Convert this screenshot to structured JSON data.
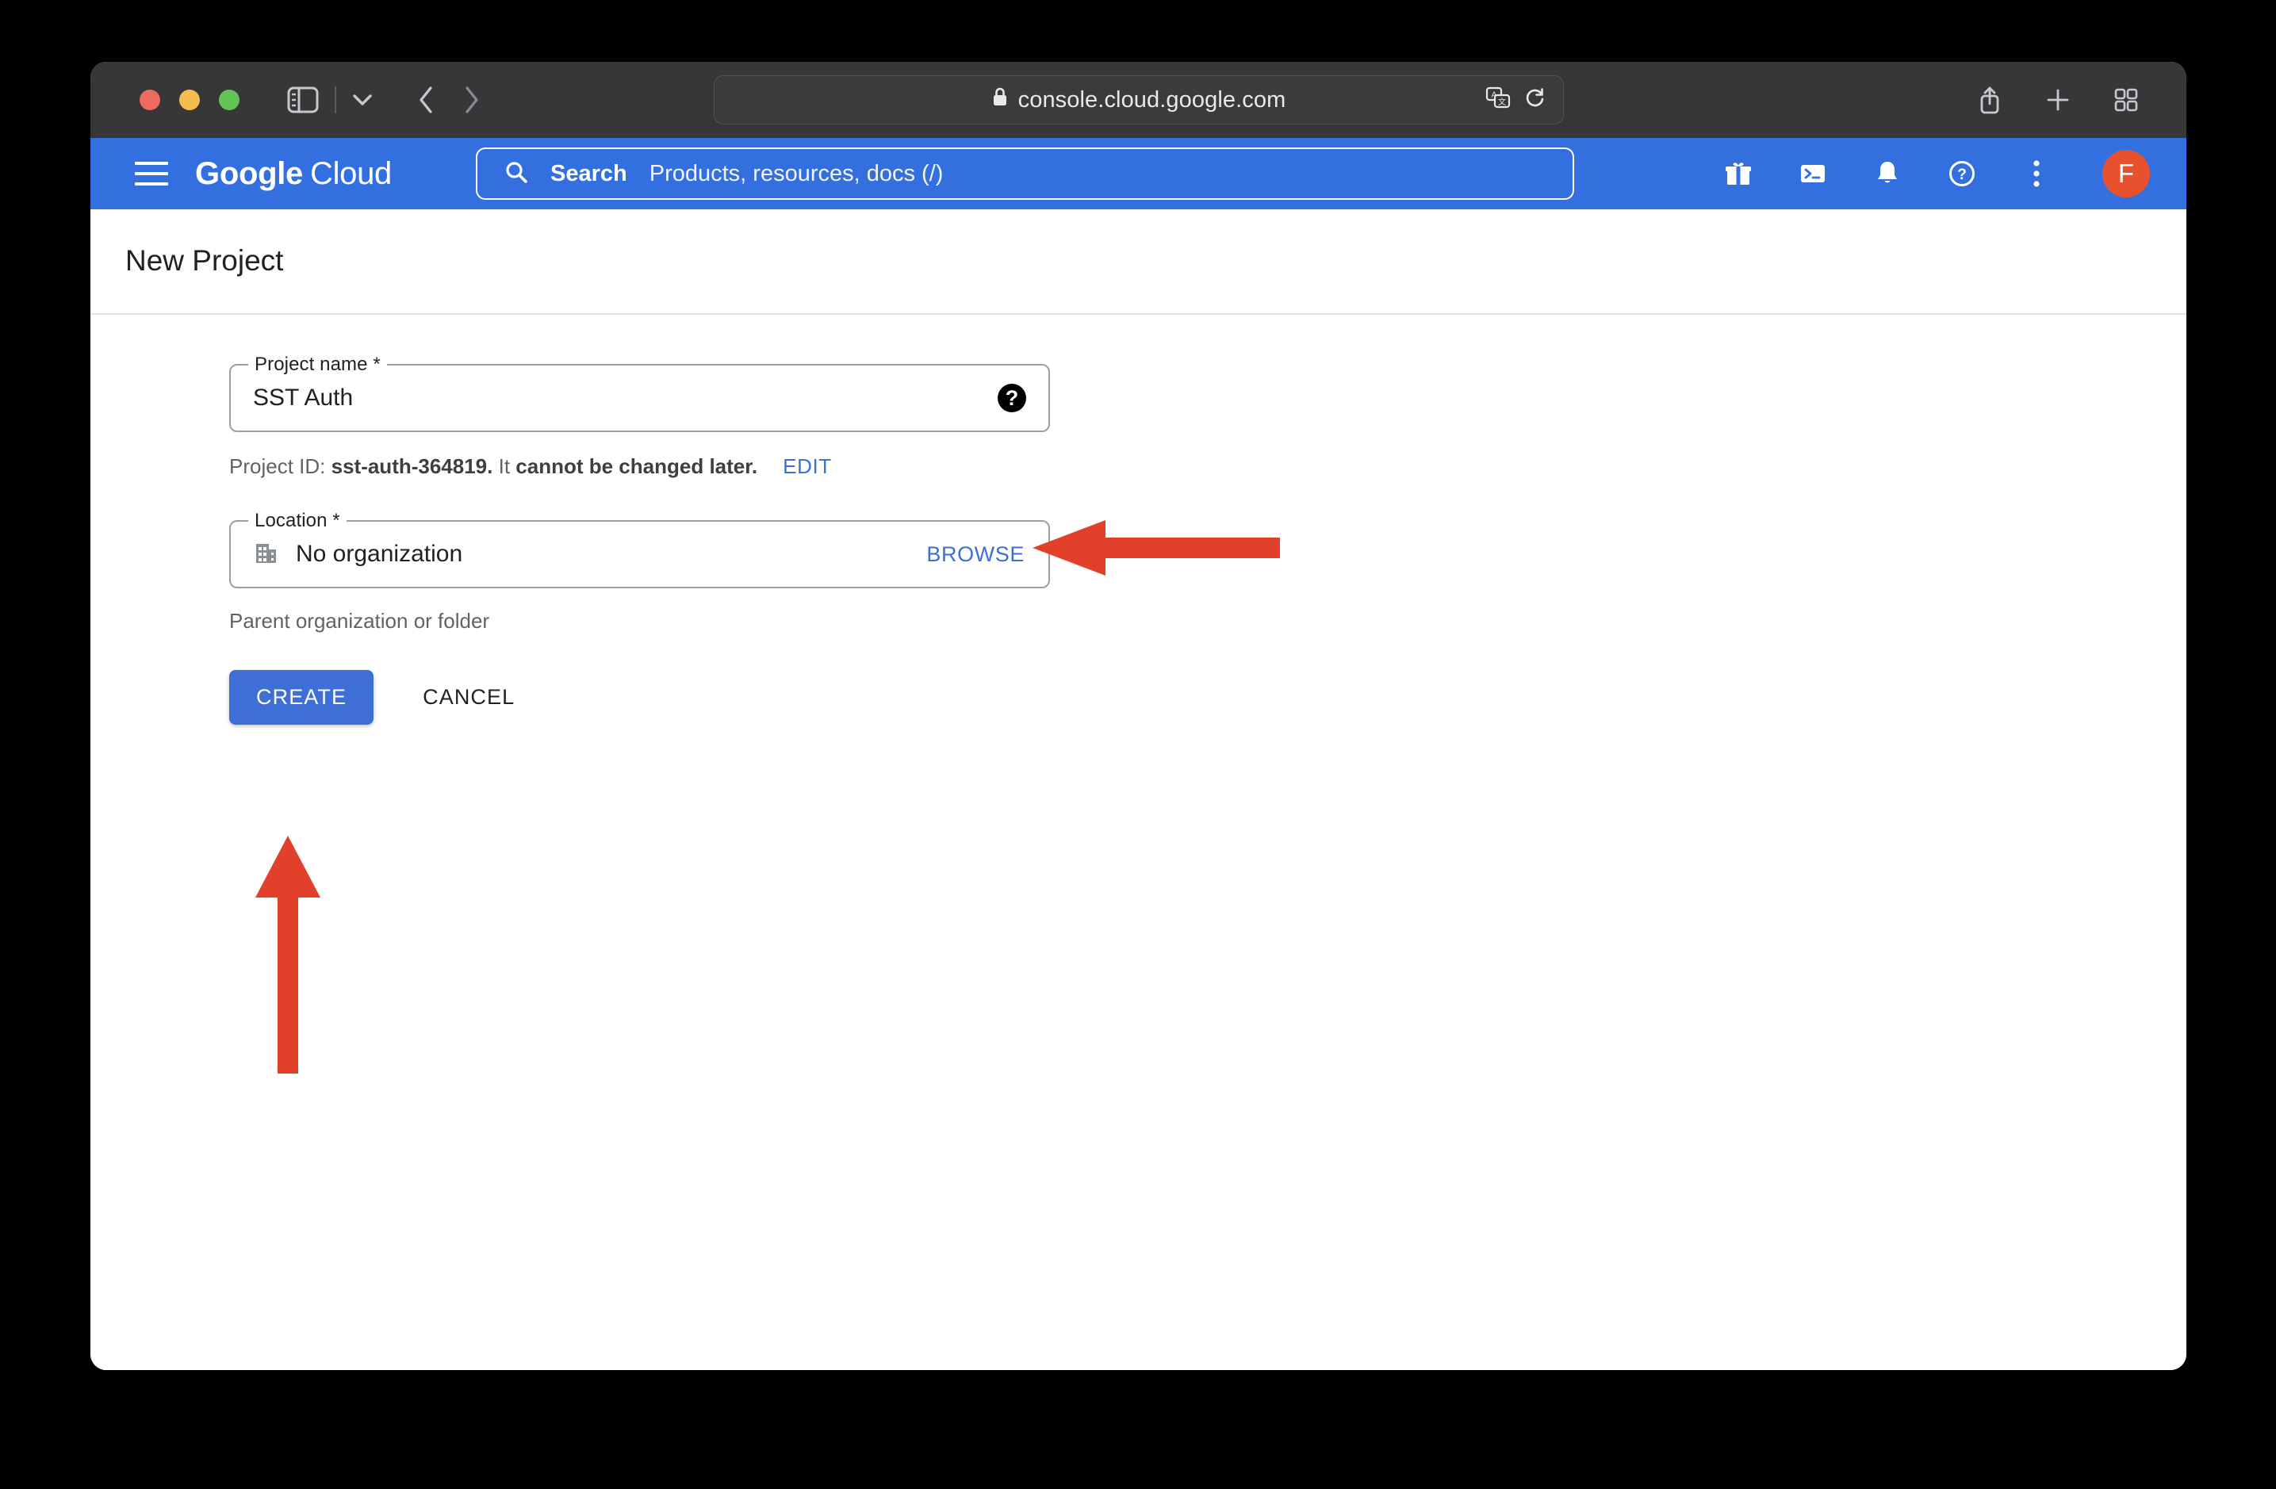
{
  "browser": {
    "url": "console.cloud.google.com",
    "lock_icon": "lock-icon",
    "traffic_lights": [
      "close",
      "minimize",
      "maximize"
    ],
    "sidebar_icon": "sidebar-toggle-icon",
    "chevron_icon": "chevron-down-icon",
    "back_icon": "back-chevron-icon",
    "forward_icon": "forward-chevron-icon",
    "translate_icon": "translate-icon",
    "reload_icon": "reload-icon",
    "share_icon": "share-icon",
    "new_tab_icon": "plus-icon",
    "tab_overview_icon": "tab-grid-icon"
  },
  "gcloud_header": {
    "menu_icon": "hamburger-menu-icon",
    "logo_bold": "Google",
    "logo_light": "Cloud",
    "search": {
      "label": "Search",
      "placeholder": "Products, resources, docs (/)",
      "icon": "search-icon"
    },
    "icons": [
      {
        "name": "gift-icon"
      },
      {
        "name": "cloud-shell-icon"
      },
      {
        "name": "notifications-bell-icon"
      },
      {
        "name": "help-circle-icon"
      },
      {
        "name": "more-vertical-icon"
      }
    ],
    "avatar_initial": "F"
  },
  "page": {
    "title": "New Project",
    "project_name": {
      "legend": "Project name *",
      "value": "SST Auth",
      "help_icon": "help-filled-icon",
      "help_glyph": "?"
    },
    "project_id": {
      "prefix": "Project ID:",
      "id": "sst-auth-364819.",
      "suffix_plain": "It",
      "suffix_bold": "cannot be changed later.",
      "edit_label": "EDIT"
    },
    "location": {
      "legend": "Location *",
      "icon": "organization-building-icon",
      "value": "No organization",
      "browse_label": "BROWSE",
      "hint": "Parent organization or folder"
    },
    "actions": {
      "create_label": "CREATE",
      "cancel_label": "CANCEL"
    }
  },
  "annotations": {
    "color": "#e1402a",
    "arrow_to_project_name": "left-arrow",
    "arrow_to_create_button": "up-arrow"
  }
}
